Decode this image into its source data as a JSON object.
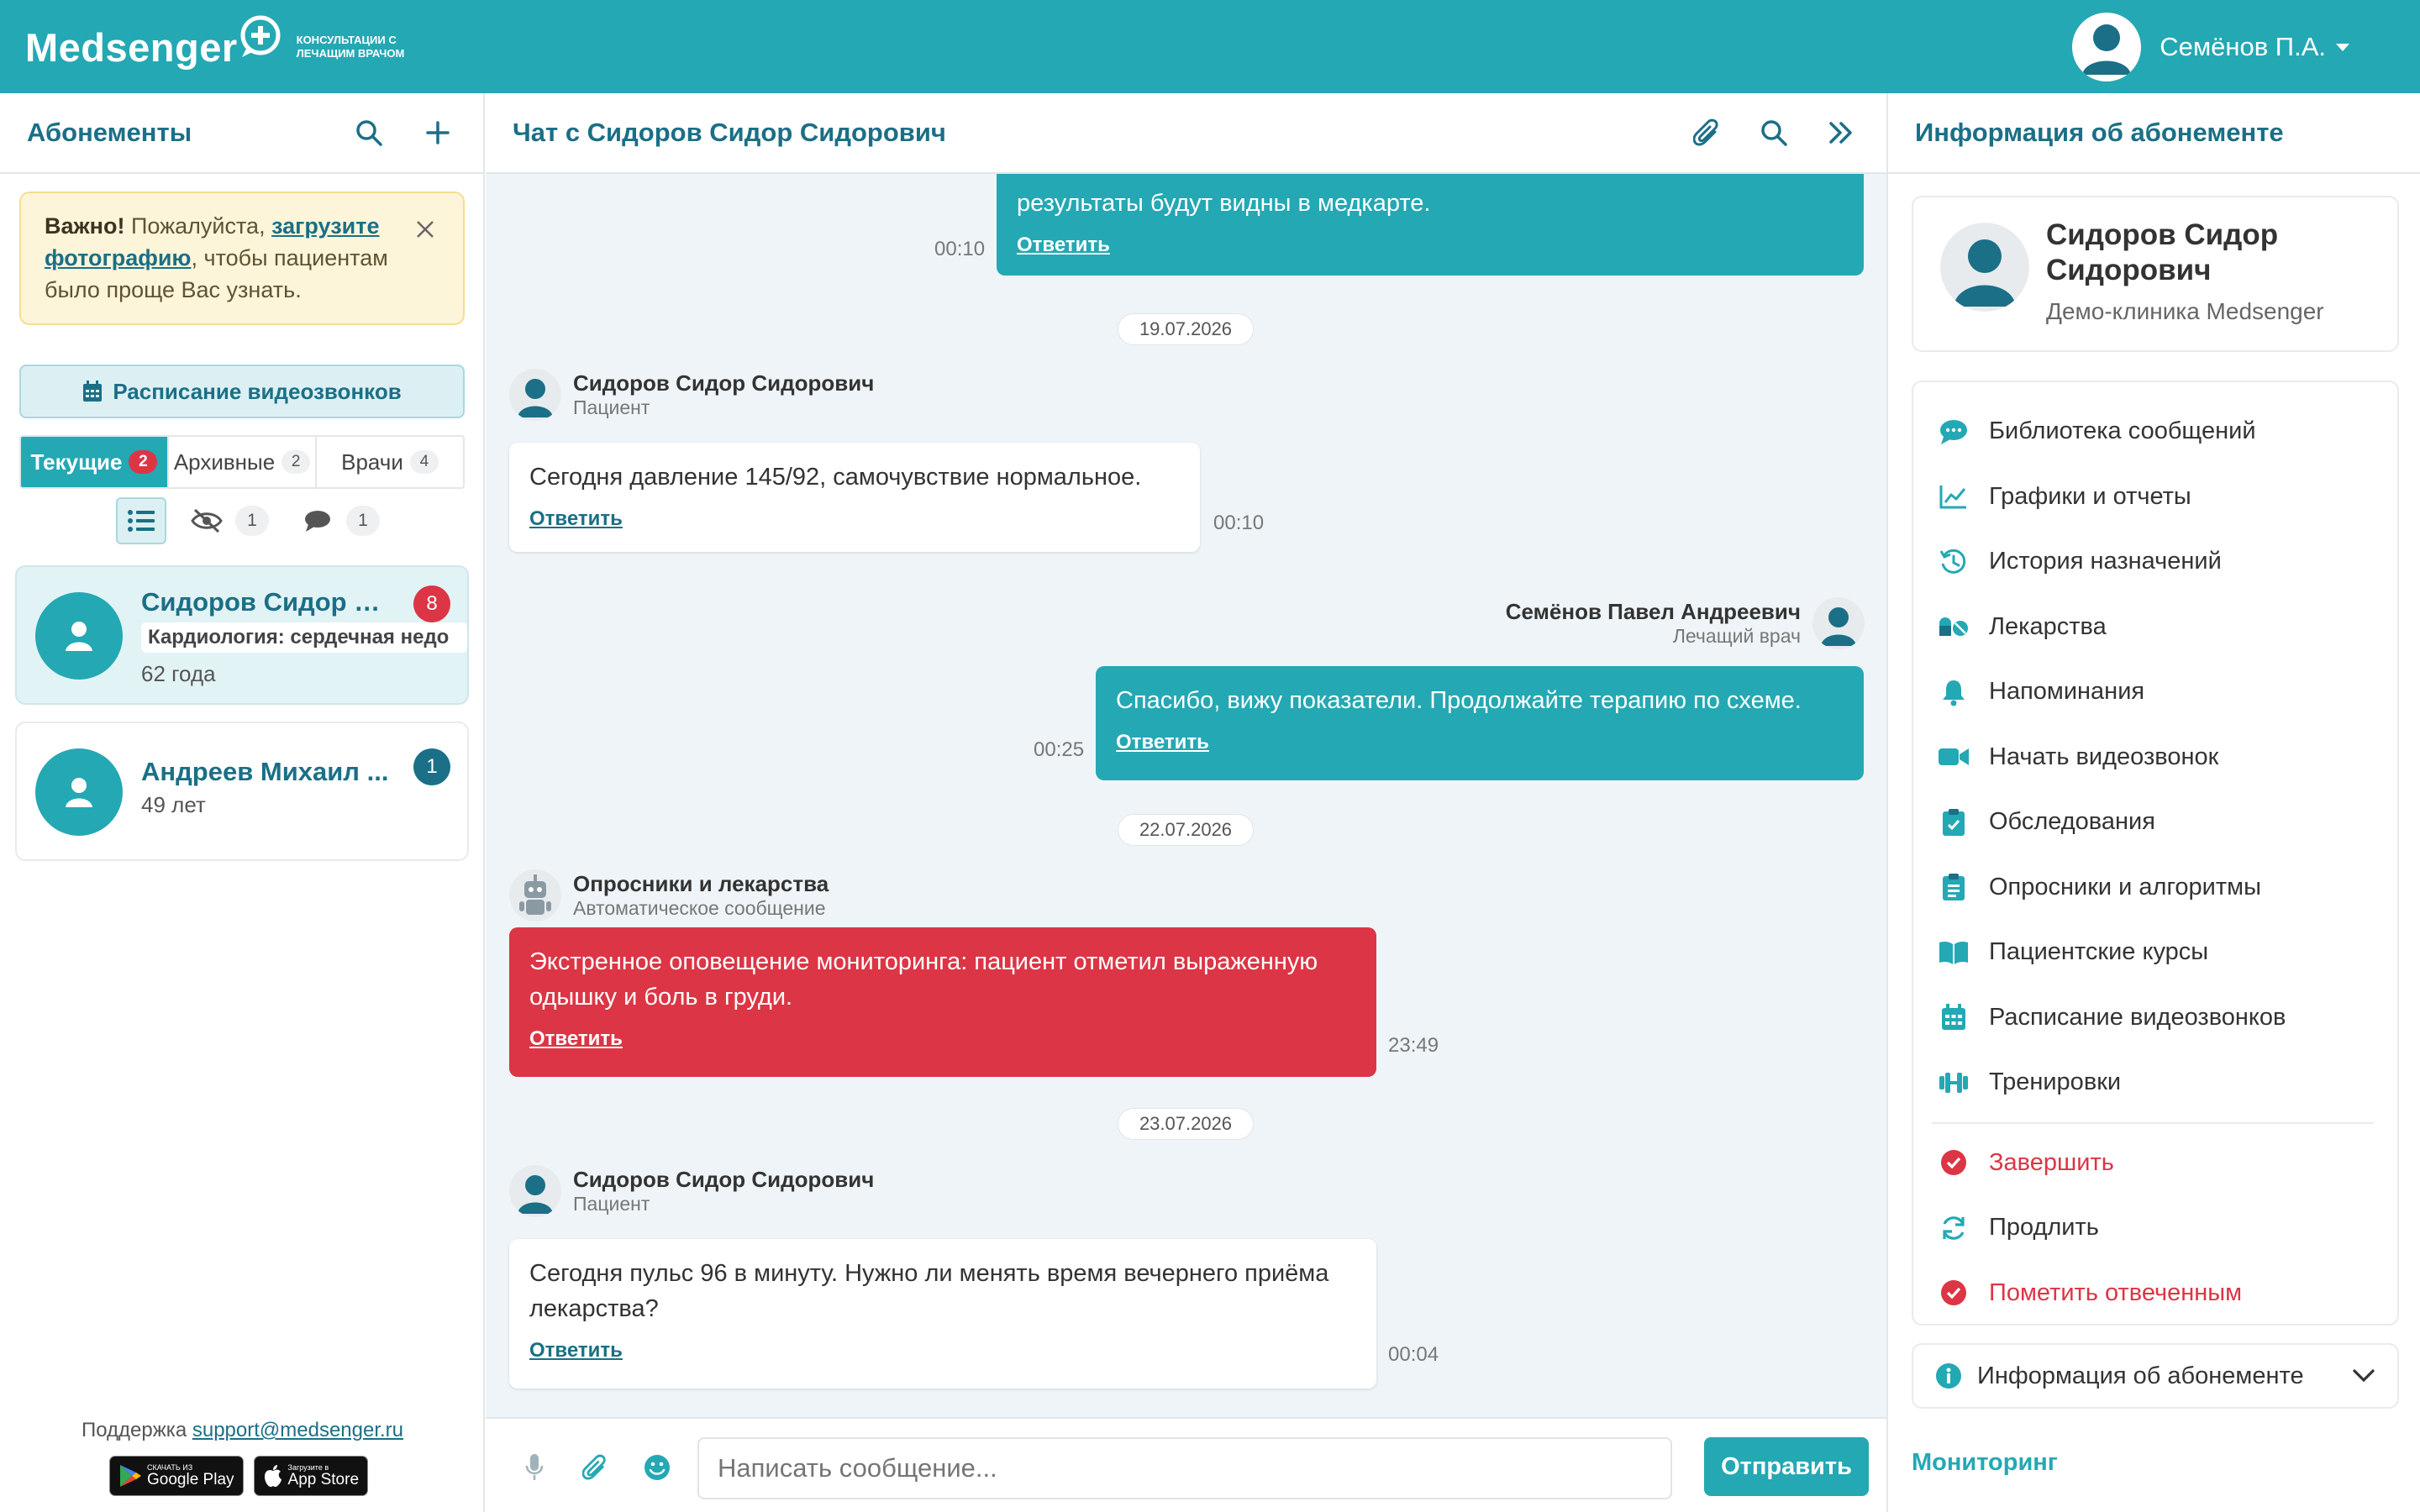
{
  "app": {
    "logo_text": "Medsenger",
    "logo_subtitle": "КОНСУЛЬТАЦИИ С ЛЕЧАЩИМ ВРАЧОМ",
    "user_name": "Семёнов П.А.",
    "colors": {
      "accent": "#24a8b4",
      "accent_dark": "#1b6f86",
      "danger": "#dc3545",
      "warning_bg": "#fdf5da"
    }
  },
  "left": {
    "title": "Абонементы",
    "notice": {
      "bold": "Важно!",
      "text1": " Пожалуйста, ",
      "link": "загрузите фотографию",
      "text2": ", чтобы пациентам было проще Вас узнать."
    },
    "schedule_button": "Расписание видеозвонков",
    "tabs": [
      {
        "label": "Текущие",
        "count": "2"
      },
      {
        "label": "Архивные",
        "count": "2"
      },
      {
        "label": "Врачи",
        "count": "4"
      }
    ],
    "filters": {
      "hidden_count": "1",
      "comments_count": "1"
    },
    "patients": [
      {
        "name": "Сидоров Сидор С...",
        "tag": "Кардиология: сердечная недо",
        "age": "62 года",
        "badge": "8"
      },
      {
        "name": "Андреев Михаил ...",
        "age": "49 лет",
        "badge": "1"
      }
    ],
    "support_label": "Поддержка ",
    "support_email": "support@medsenger.ru",
    "google_play": {
      "small": "СКАЧАТЬ ИЗ",
      "big": "Google Play"
    },
    "app_store": {
      "small": "Загрузите в",
      "big": "App Store"
    }
  },
  "chat": {
    "title": "Чат с Сидоров Сидор Сидорович",
    "reply_label": "Ответить",
    "messages": [
      {
        "text": "результаты будут видны в медкарте.",
        "time": "00:10"
      },
      {
        "date": "19.07.2026"
      },
      {
        "sender": "Сидоров Сидор Сидорович",
        "role": "Пациент",
        "text": "Сегодня давление 145/92, самочувствие нормальное.",
        "time": "00:10"
      },
      {
        "sender": "Семёнов Павел Андреевич",
        "role": "Лечащий врач",
        "text": "Спасибо, вижу показатели. Продолжайте терапию по схеме.",
        "time": "00:25"
      },
      {
        "date": "22.07.2026"
      },
      {
        "sender": "Опросники и лекарства",
        "role": "Автоматическое сообщение",
        "text": "Экстренное оповещение мониторинга: пациент отметил выраженную одышку и боль в груди.",
        "time": "23:49"
      },
      {
        "date": "23.07.2026"
      },
      {
        "sender": "Сидоров Сидор Сидорович",
        "role": "Пациент",
        "text": "Сегодня пульс 96 в минуту. Нужно ли менять время вечернего приёма лекарства?",
        "time": "00:04"
      }
    ],
    "composer": {
      "placeholder": "Написать сообщение...",
      "send": "Отправить"
    }
  },
  "right": {
    "title": "Информация об абонементе",
    "patient_name": "Сидоров Сидор Сидорович",
    "clinic": "Демо-клиника Medsenger",
    "menu": [
      {
        "label": "Библиотека сообщений",
        "icon": "chat-bubble-icon"
      },
      {
        "label": "Графики и отчеты",
        "icon": "line-chart-icon"
      },
      {
        "label": "История назначений",
        "icon": "history-icon"
      },
      {
        "label": "Лекарства",
        "icon": "pills-icon"
      },
      {
        "label": "Напоминания",
        "icon": "bell-icon"
      },
      {
        "label": "Начать видеозвонок",
        "icon": "video-camera-icon"
      },
      {
        "label": "Обследования",
        "icon": "clipboard-check-icon"
      },
      {
        "label": "Опросники и алгоритмы",
        "icon": "clipboard-list-icon"
      },
      {
        "label": "Пациентские курсы",
        "icon": "book-icon"
      },
      {
        "label": "Расписание видеозвонков",
        "icon": "calendar-icon"
      },
      {
        "label": "Тренировки",
        "icon": "dumbbell-icon"
      },
      {
        "label": "Завершить",
        "icon": "check-circle-icon"
      },
      {
        "label": "Продлить",
        "icon": "refresh-icon"
      },
      {
        "label": "Пометить отвеченным",
        "icon": "check-circle-icon"
      }
    ],
    "info_bar": "Информация об абонементе",
    "monitoring": "Мониторинг"
  }
}
